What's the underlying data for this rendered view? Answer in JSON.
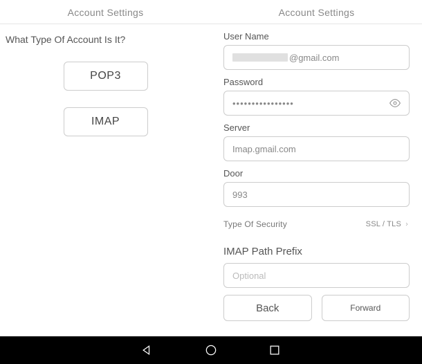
{
  "left": {
    "header": "Account Settings",
    "question": "What Type Of Account Is It?",
    "pop3_label": "POP3",
    "imap_label": "IMAP"
  },
  "right": {
    "header": "Account Settings",
    "username_label": "User Name",
    "username_suffix": "@gmail.com",
    "password_label": "Password",
    "password_value": "••••••••••••••••",
    "server_label": "Server",
    "server_value": "Imap.gmail.com",
    "door_label": "Door",
    "door_value": "993",
    "security_label": "Type Of Security",
    "security_value": "SSL / TLS",
    "prefix_label": "IMAP Path Prefix",
    "prefix_placeholder": "Optional",
    "back_label": "Back",
    "forward_label": "Forward"
  }
}
